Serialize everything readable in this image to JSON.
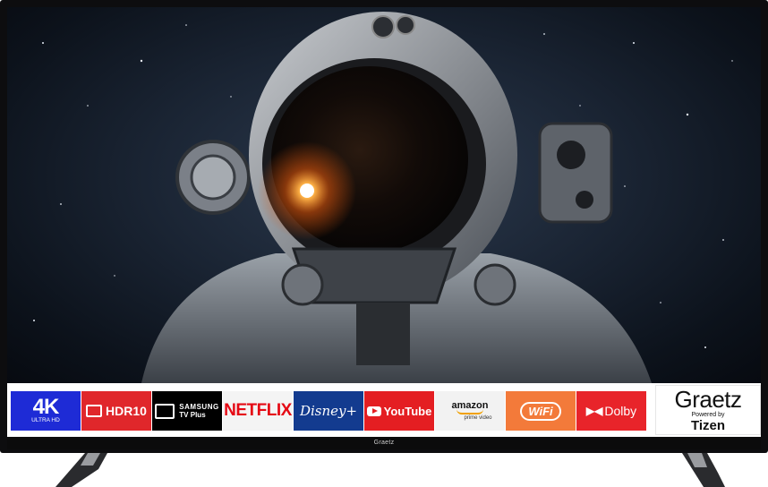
{
  "brand_label": "Graetz",
  "logos": {
    "k4_big": "4K",
    "k4_small": "ULTRA HD",
    "hdr": "HDR10",
    "samsung_1": "SAMSUNG",
    "samsung_2": "TV Plus",
    "netflix": "NETFLIX",
    "disney": "Disney+",
    "youtube": "YouTube",
    "amazon_1": "amazon",
    "amazon_2": "prime video",
    "wifi": "WiFi",
    "dolby": "Dolby",
    "graetz_1": "Graetz",
    "graetz_2": "Powered by",
    "graetz_3": "Tizen"
  },
  "colors": {
    "bezel": "#0d0d0f",
    "4k": "#1e2bd6",
    "hdr": "#e0272b",
    "netflix": "#e50914",
    "disney": "#133b8f",
    "youtube": "#e41e22",
    "wifi": "#f37a3a",
    "dolby": "#e8242a"
  }
}
